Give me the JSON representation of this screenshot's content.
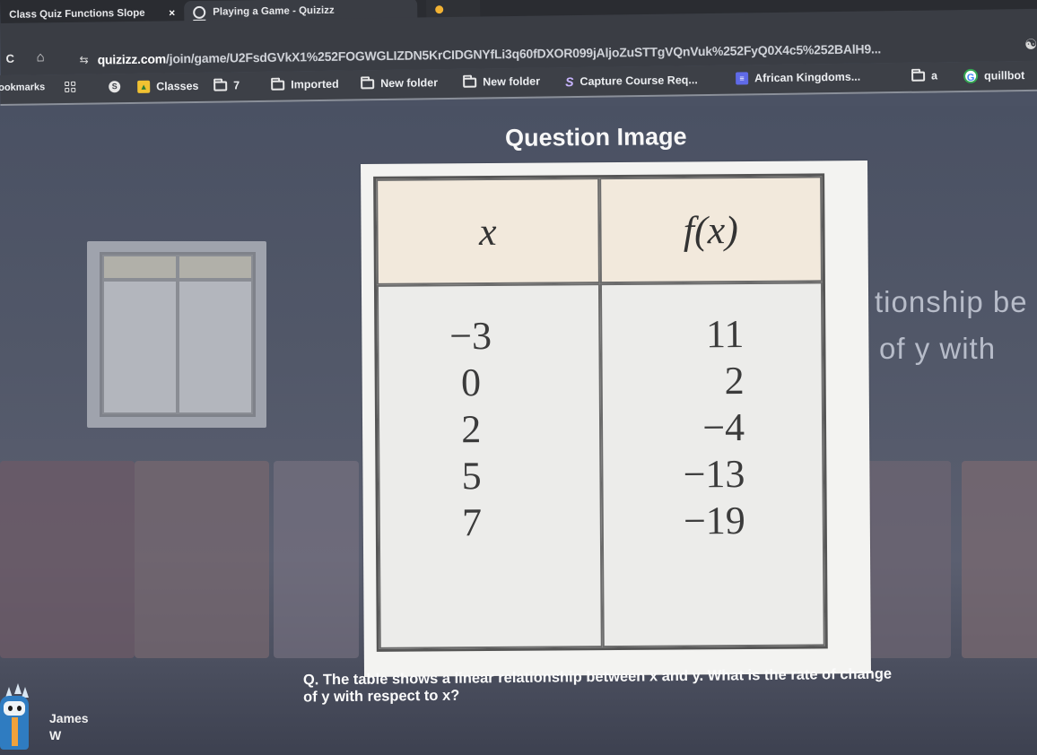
{
  "browser": {
    "tabs": [
      {
        "title": "Class Quiz Functions Slope",
        "active": false,
        "close": "×"
      },
      {
        "title": "Playing a Game - Quizizz",
        "active": true
      }
    ],
    "address_bar": {
      "host": "quizizz.com",
      "path": "/join/game/U2FsdGVkX1%252FOGWGLIZDN5KrCIDGNYfLi3q60fDXOR099jAljoZuSTTgVQnVuk%252FyQ0X4c5%252BAlH9..."
    },
    "nav": {
      "reload": "C",
      "home": "⌂",
      "site_settings": "⇆"
    },
    "bookmarks": [
      {
        "label": "ookmarks",
        "icon": "none"
      },
      {
        "label": "",
        "icon": "apps-icon"
      },
      {
        "label": "",
        "icon": "circle-icon"
      },
      {
        "label": "Classes",
        "icon": "classes-icon"
      },
      {
        "label": "7",
        "icon": "folder-icon"
      },
      {
        "label": "Imported",
        "icon": "folder-icon"
      },
      {
        "label": "New folder",
        "icon": "folder-icon"
      },
      {
        "label": "New folder",
        "icon": "folder-icon"
      },
      {
        "label": "Capture Course Req...",
        "icon": "capture-icon"
      },
      {
        "label": "African Kingdoms...",
        "icon": "forms-icon"
      },
      {
        "label": "a",
        "icon": "folder-icon"
      },
      {
        "label": "quillbot",
        "icon": "google-icon"
      }
    ]
  },
  "main": {
    "section_title": "Question Image",
    "background_text": [
      "tionship be",
      "of y with"
    ],
    "table": {
      "headers": [
        "x",
        "f(x)"
      ],
      "x_values": [
        "−3",
        "0",
        "2",
        "5",
        "7"
      ],
      "fx_values": [
        "11",
        "2",
        "−4",
        "−13",
        "−19"
      ]
    },
    "question": "Q. The table shows a linear relationship between x and y. What is the rate of change of y with respect to x?",
    "player": {
      "first_name": "James",
      "last_initial": "W"
    }
  }
}
